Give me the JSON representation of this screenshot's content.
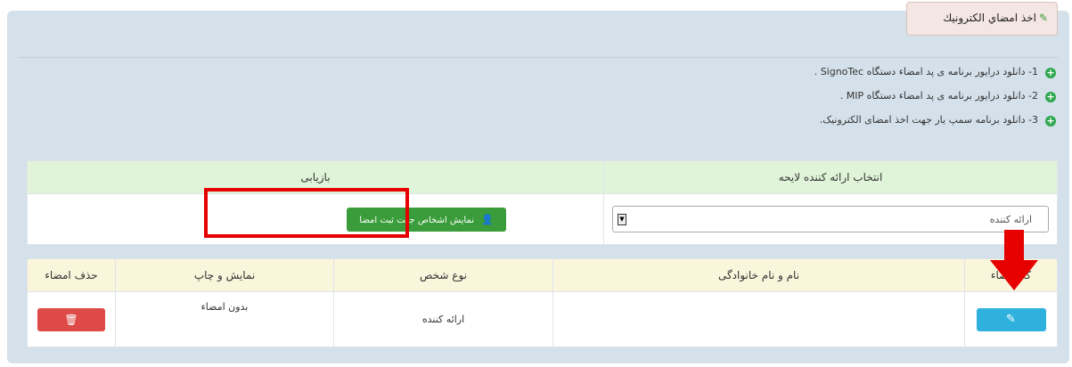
{
  "tab": {
    "title": "اخذ امضاي الكترونيك",
    "icon": "pencil-square-icon"
  },
  "links": [
    "1- دانلود درایور برنامه ی پد امضاء دستگاه SignoTec .",
    "2- دانلود درایور برنامه ی پد امضاء دستگاه MIP .",
    "3- دانلود برنامه سمپ یار جهت اخذ امضای الکترونیک."
  ],
  "form_table": {
    "headers": [
      "انتخاب ارائه کننده لایحه",
      "بازیابی"
    ],
    "select_value": "ارائه کننده",
    "show_button": "نمایش اشخاص جهت ثبت امضا"
  },
  "results_table": {
    "headers": [
      "کد امضاء",
      "نام و نام خانوادگی",
      "نوع شخص",
      "نمایش و چاپ",
      "حذف امضاء"
    ],
    "rows": [
      {
        "name": "",
        "type": "ارائه کننده",
        "view": "بدون امضاء"
      }
    ]
  },
  "colors": {
    "annotation": "#e60000",
    "edit_button": "#2eb2dd",
    "delete_button": "#dd4a47",
    "show_button": "#3a9c3a"
  }
}
